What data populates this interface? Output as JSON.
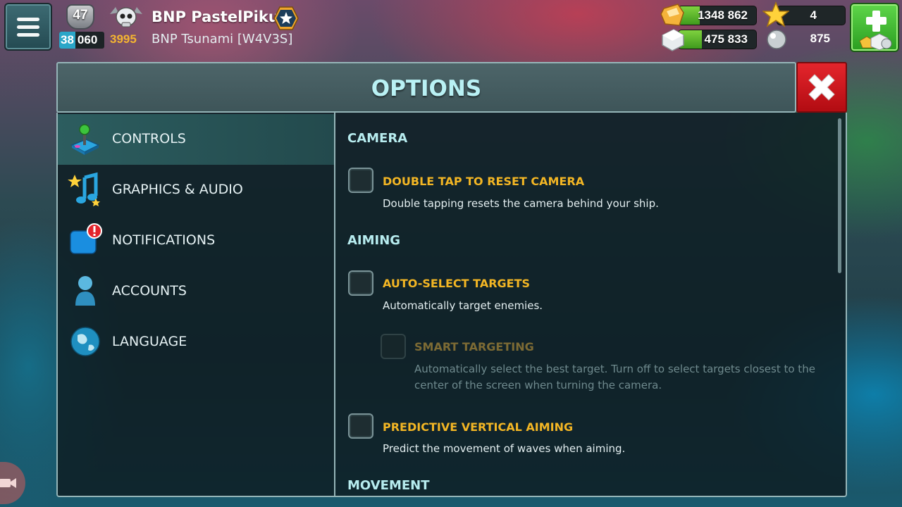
{
  "hud": {
    "level": "47",
    "trophies_highlight": "38",
    "trophies_rest": "060",
    "gold": "3995",
    "player_name": "BNP PastelPiku",
    "guild": "BNP Tsunami [W4V3S]",
    "resources": {
      "gems": {
        "value": "1348 862",
        "fill_fraction": 0.27,
        "color": "#f2a23a"
      },
      "stars": {
        "value": "4",
        "fill_fraction": 0.0
      },
      "marble": {
        "value": "475 833",
        "fill_fraction": 0.3
      },
      "pearls": {
        "value": "875"
      }
    },
    "icons": {
      "menu": "hamburger-menu-icon",
      "shop": "plus-shop-icon"
    }
  },
  "options": {
    "title": "OPTIONS",
    "sidebar": [
      {
        "label": "CONTROLS",
        "icon": "joystick-icon",
        "active": true
      },
      {
        "label": "GRAPHICS & AUDIO",
        "icon": "star-music-note-icon",
        "active": false
      },
      {
        "label": "NOTIFICATIONS",
        "icon": "notification-alert-icon",
        "active": false
      },
      {
        "label": "ACCOUNTS",
        "icon": "person-icon",
        "active": false
      },
      {
        "label": "LANGUAGE",
        "icon": "globe-icon",
        "active": false
      }
    ],
    "sections": {
      "camera": "CAMERA",
      "aiming": "AIMING",
      "movement": "MOVEMENT"
    },
    "settings": {
      "double_tap": {
        "label": "DOUBLE TAP TO RESET CAMERA",
        "desc": "Double tapping resets the camera behind your ship.",
        "checked": false
      },
      "auto_select": {
        "label": "AUTO-SELECT TARGETS",
        "desc": "Automatically target enemies.",
        "checked": false
      },
      "smart_targeting": {
        "label": "SMART TARGETING",
        "desc": "Automatically select the best target. Turn off to select targets closest to the center of the screen when turning the camera.",
        "checked": false,
        "disabled": true
      },
      "predictive": {
        "label": "PREDICTIVE VERTICAL AIMING",
        "desc": "Predict the movement of waves when aiming.",
        "checked": false
      }
    }
  },
  "colors": {
    "accent_title": "#b9f1f4",
    "option_label": "#f3b624",
    "close_red": "#e4252c",
    "shop_green": "#3fbf2f"
  }
}
